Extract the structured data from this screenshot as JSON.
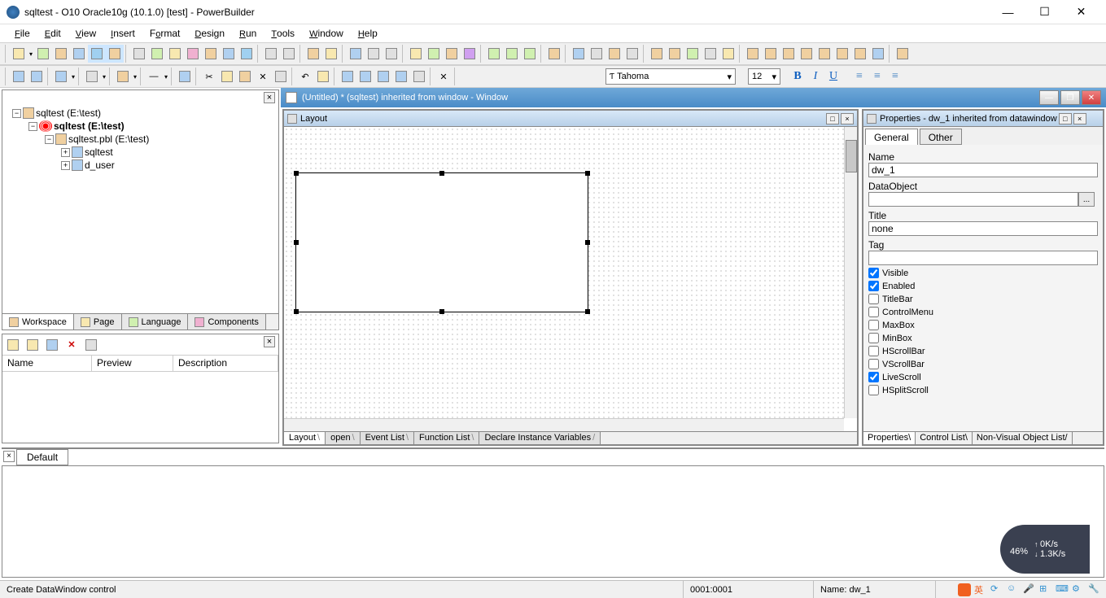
{
  "title": "sqltest - O10 Oracle10g (10.1.0) [test]  - PowerBuilder",
  "menus": [
    "File",
    "Edit",
    "View",
    "Insert",
    "Format",
    "Design",
    "Run",
    "Tools",
    "Window",
    "Help"
  ],
  "font": {
    "name": "Tahoma",
    "size": "12"
  },
  "tree": {
    "n1": "sqltest (E:\\test)",
    "n2": "sqltest (E:\\test)",
    "n3": "sqltest.pbl (E:\\test)",
    "n4": "sqltest",
    "n5": "d_user"
  },
  "ws_tabs": [
    "Workspace",
    "Page",
    "Language",
    "Components"
  ],
  "list_cols": [
    "Name",
    "Preview",
    "Description"
  ],
  "mdi_title": "(Untitled) * (sqltest) inherited from window - Window",
  "layout_title": "Layout",
  "layout_tabs": [
    "Layout",
    "open",
    "Event List",
    "Function List",
    "Declare Instance Variables"
  ],
  "props_title": "Properties - dw_1 inherited from datawindow",
  "props_tabs": [
    "General",
    "Other"
  ],
  "props": {
    "name_lbl": "Name",
    "name_val": "dw_1",
    "do_lbl": "DataObject",
    "do_val": "",
    "title_lbl": "Title",
    "title_val": "none",
    "tag_lbl": "Tag",
    "tag_val": "",
    "chk": [
      "Visible",
      "Enabled",
      "TitleBar",
      "ControlMenu",
      "MaxBox",
      "MinBox",
      "HScrollBar",
      "VScrollBar",
      "LiveScroll",
      "HSplitScroll"
    ],
    "chk_state": [
      true,
      true,
      false,
      false,
      false,
      false,
      false,
      false,
      true,
      false
    ]
  },
  "props_btabs": [
    "Properties",
    "Control List",
    "Non-Visual Object List"
  ],
  "output_tab": "Default",
  "status": {
    "msg": "Create DataWindow control",
    "pos": "0001:0001",
    "name": "Name: dw_1"
  },
  "gauge": {
    "pct": "46",
    "u": "%",
    "up": "0K/s",
    "dn": "1.3K/s"
  }
}
